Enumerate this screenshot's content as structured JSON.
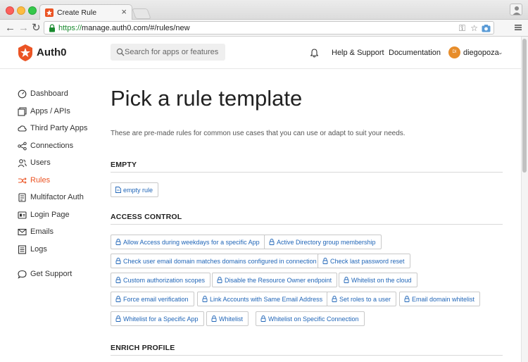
{
  "browser": {
    "tab_title": "Create Rule",
    "tab_close": "×",
    "url_scheme": "https://",
    "url_rest": "manage.auth0.com/#/rules/new"
  },
  "header": {
    "logo_text": "Auth0",
    "search_placeholder": "Search for apps or features",
    "help_label": "Help & Support",
    "docs_label": "Documentation",
    "avatar_initials": "DI",
    "username": "diegopoza"
  },
  "sidebar": {
    "items": [
      {
        "label": "Dashboard",
        "icon": "dashboard-icon"
      },
      {
        "label": "Apps / APIs",
        "icon": "apps-icon"
      },
      {
        "label": "Third Party Apps",
        "icon": "cloud-icon"
      },
      {
        "label": "Connections",
        "icon": "connections-icon"
      },
      {
        "label": "Users",
        "icon": "users-icon"
      },
      {
        "label": "Rules",
        "icon": "rules-icon",
        "active": true
      },
      {
        "label": "Multifactor Auth",
        "icon": "multifactor-icon"
      },
      {
        "label": "Login Page",
        "icon": "login-page-icon"
      },
      {
        "label": "Emails",
        "icon": "email-icon"
      },
      {
        "label": "Logs",
        "icon": "logs-icon"
      },
      {
        "label": "Get Support",
        "icon": "chat-icon"
      }
    ]
  },
  "main": {
    "title": "Pick a rule template",
    "description": "These are pre-made rules for common use cases that you can use or adapt to suit your needs.",
    "sections": [
      {
        "title": "EMPTY",
        "templates": [
          "empty rule"
        ]
      },
      {
        "title": "ACCESS CONTROL",
        "templates": [
          "Allow Access during weekdays for a specific App",
          "Active Directory group membership",
          "Check user email domain matches domains configured in connection",
          "Check last password reset",
          "Custom authorization scopes",
          "Disable the Resource Owner endpoint",
          "Whitelist on the cloud",
          "Force email verification",
          "Link Accounts with Same Email Address",
          "Set roles to a user",
          "Email domain whitelist",
          "Whitelist for a Specific App",
          "Whitelist",
          "Whitelist on Specific Connection"
        ]
      },
      {
        "title": "ENRICH PROFILE",
        "templates": []
      }
    ]
  },
  "colors": {
    "accent": "#eb5424",
    "link": "#2166b8",
    "avatar": "#e78d2b"
  }
}
